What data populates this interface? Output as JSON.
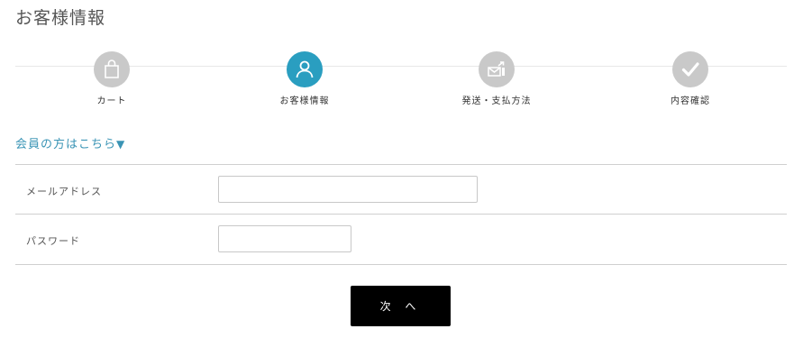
{
  "page": {
    "title": "お客様情報"
  },
  "steps": [
    {
      "label": "カート",
      "icon": "shopping-bag-icon",
      "active": false
    },
    {
      "label": "お客様情報",
      "icon": "user-icon",
      "active": true
    },
    {
      "label": "発送・支払方法",
      "icon": "shipping-envelope-icon",
      "active": false
    },
    {
      "label": "内容確認",
      "icon": "checkmark-icon",
      "active": false
    }
  ],
  "member_link": {
    "text": "会員の方はこちら",
    "arrow": "▼"
  },
  "form": {
    "email": {
      "label": "メールアドレス",
      "value": "",
      "placeholder": ""
    },
    "password": {
      "label": "パスワード",
      "value": "",
      "placeholder": ""
    }
  },
  "next_button": {
    "label": "次 へ"
  },
  "colors": {
    "accent": "#2a9ec0",
    "inactive_step": "#c9c9c9",
    "link": "#3a94b5",
    "button": "#000000"
  }
}
